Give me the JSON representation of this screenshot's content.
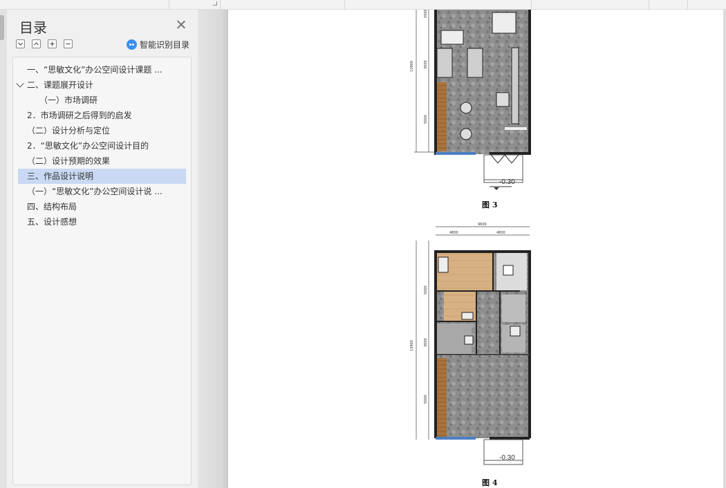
{
  "toc_panel": {
    "title": "目录",
    "smart_toc_label": "智能识别目录",
    "items": [
      {
        "label": "一、“思敏文化”办公空间设计课题 ...",
        "indent": 0,
        "expander": false,
        "selected": false
      },
      {
        "label": "二、课题展开设计",
        "indent": 0,
        "expander": true,
        "selected": false
      },
      {
        "label": "（一）市场调研",
        "indent": 1,
        "expander": false,
        "selected": false
      },
      {
        "label": "2．市场调研之后得到的启发",
        "indent": 0,
        "expander": false,
        "selected": false
      },
      {
        "label": "（二）设计分析与定位",
        "indent": 0,
        "expander": false,
        "selected": false
      },
      {
        "label": "2．“思敏文化”办公空间设计目的",
        "indent": 0,
        "expander": false,
        "selected": false
      },
      {
        "label": "（二）设计预期的效果",
        "indent": 0,
        "expander": false,
        "selected": false
      },
      {
        "label": "三、作品设计说明",
        "indent": 0,
        "expander": false,
        "selected": true
      },
      {
        "label": "（一）“思敏文化”办公空间设计说 ...",
        "indent": 0,
        "expander": false,
        "selected": false
      },
      {
        "label": "四、结构布局",
        "indent": 0,
        "expander": false,
        "selected": false
      },
      {
        "label": "五、设计感想",
        "indent": 0,
        "expander": false,
        "selected": false
      }
    ],
    "selection_color": "#c9d9f3"
  },
  "document": {
    "figure3": {
      "caption": "图 3",
      "level_mark": "-0.30",
      "dims_left": [
        "5000",
        "13900",
        "3000",
        "5000"
      ]
    },
    "figure4": {
      "caption": "图 4",
      "level_mark": "-0.30",
      "dims_top": [
        "9600",
        "4800",
        "4800"
      ],
      "dims_left": [
        "5000",
        "13900",
        "3000",
        "5000"
      ]
    }
  }
}
